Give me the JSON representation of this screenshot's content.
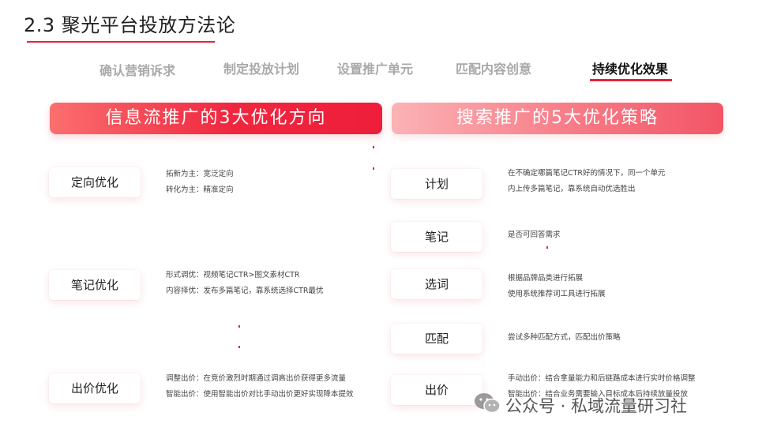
{
  "title": "2.3 聚光平台投放方法论",
  "steps": [
    {
      "label": "确认营销诉求"
    },
    {
      "label": "制定投放计划"
    },
    {
      "label": "设置推广单元"
    },
    {
      "label": "匹配内容创意"
    },
    {
      "label": "持续优化效果",
      "active": true
    }
  ],
  "left": {
    "banner": "信息流推广的3大优化方向",
    "items": [
      {
        "label": "定向优化",
        "lines": [
          "拓新为主：宽泛定向",
          "转化为主：精准定向"
        ]
      },
      {
        "label": "笔记优化",
        "lines": [
          "形式调优：视频笔记CTR>图文素材CTR",
          "内容择优：发布多篇笔记，靠系统选择CTR最优"
        ]
      },
      {
        "label": "出价优化",
        "lines": [
          "调整出价：在竞价激烈时期通过调高出价获得更多流量",
          "智能出价：使用智能出价对比手动出价更好实现降本提效"
        ]
      }
    ]
  },
  "right": {
    "banner": "搜索推广的5大优化策略",
    "items": [
      {
        "label": "计划",
        "lines": [
          "在不确定哪篇笔记CTR好的情况下，同一个单元",
          "内上传多篇笔记，靠系统自动优选胜出"
        ]
      },
      {
        "label": "笔记",
        "lines": [
          "是否可回答需求"
        ]
      },
      {
        "label": "选词",
        "lines": [
          "根据品牌品类进行拓展",
          "使用系统推荐词工具进行拓展"
        ]
      },
      {
        "label": "匹配",
        "lines": [
          "尝试多种匹配方式，匹配出价策略"
        ]
      },
      {
        "label": "出价",
        "lines": [
          "手动出价：结合拿量能力和后链路成本进行实时价格调整",
          "智能出价：结合业务需要输入目标成本后持续放量投放"
        ]
      }
    ]
  },
  "watermark": {
    "icon": "wechat-icon",
    "text": "公众号 · 私域流量研习社"
  },
  "colors": {
    "accent": "#e8233a",
    "banner_left": "#f0263f",
    "banner_right": "#f77b86"
  }
}
